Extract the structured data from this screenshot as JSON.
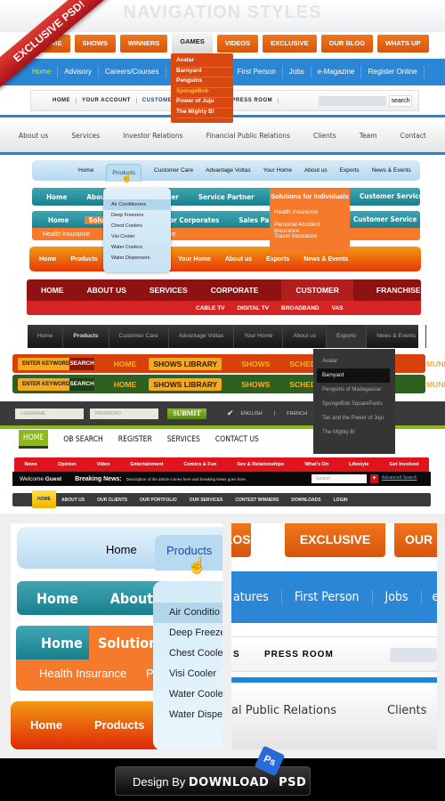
{
  "header": {
    "title": "NAVIGATION STYLES",
    "ribbon": "EXCLUSIVE PSD!"
  },
  "orange_tabs": [
    "HOME",
    "SHOWS",
    "WINNERS",
    "GAMES",
    "VIDEOS",
    "EXCLUSIVE",
    "OUR BLOG",
    "WHATS UP"
  ],
  "games_dropdown": [
    "Avatar",
    "Barnyard",
    "Penguins",
    "SpongeBob",
    "Power of Juju",
    "The Mighty B!"
  ],
  "blue_nav": [
    "Home",
    "Advisory",
    "Careers/Courses",
    "Regi",
    "eatures",
    "First Person",
    "Jobs",
    "e-Magazine",
    "Register Online"
  ],
  "white_nav": {
    "items": [
      "HOME",
      "YOUR ACCOUNT",
      "CUSTOMER SERVI",
      "CES",
      "PRESS ROOM"
    ],
    "search_button": "search"
  },
  "gray_nav": [
    "About us",
    "Services",
    "Investor Relations",
    "Financial Public Relations",
    "Clients",
    "Team",
    "Contact"
  ],
  "lightblue_nav": [
    "Home",
    "Products",
    "Customer Care",
    "Advantage Voltas",
    "Your Home",
    "About us",
    "Exports",
    "News & Events"
  ],
  "teal_nav1": [
    "Home",
    "About Us",
    "les Partner",
    "Service Partner"
  ],
  "teal_nav1_right": "Customer Service",
  "solutions_individuals": "Solutions for Individuals",
  "solutions_dropdown": [
    "Health Insurance",
    "Personal Accident Insurance",
    "Travel Insurance"
  ],
  "teal_nav2": [
    "Home",
    "Solutions",
    "utions for Corporates",
    "Sales Pa"
  ],
  "teal_nav2_right": "Customer Service",
  "teal_nav2_sub": [
    "Health Insurance",
    "Pe",
    "Travel Insurance"
  ],
  "products_dropdown": [
    "Air Conditioners",
    "Deep Freezers",
    "Chest Coolers",
    "Visi Cooler",
    "Water Coolers",
    "Water Dispensers"
  ],
  "orange_nav": [
    "Home",
    "Products",
    "Advantage Voltas",
    "Your Home",
    "About us",
    "Exports",
    "News & Events"
  ],
  "red_nav": {
    "items": [
      "HOME",
      "ABOUT US",
      "SERVICES",
      "CORPORATE",
      "CUSTOMER",
      "FRANCHISEE"
    ],
    "sub": [
      "CABLE TV",
      "DIGITAL TV",
      "BROADBAND",
      "VAS"
    ]
  },
  "dark_nav": [
    "Home",
    "Products",
    "Customer Care",
    "Advantage Voltas",
    "Your Home",
    "About us",
    "Exports",
    "News & Events"
  ],
  "dark_dropdown": [
    "Avatar",
    "Barnyard",
    "Penguins of Madagascar",
    "SpongeBob SquarePants",
    "Tak and the Power of Juju",
    "The Mighty B!"
  ],
  "keyword_bar": {
    "placeholder": "ENTER KEYWORD",
    "search": "SEARCH",
    "items": [
      "HOME",
      "SHOWS LIBRARY",
      "SHOWS",
      "SCHEDULE",
      "MUNITY"
    ]
  },
  "login_bar": {
    "username": "USERNAME",
    "password": "PASSWORD",
    "submit": "SUBMIT",
    "english": "ENGLISH",
    "sep": "|",
    "french": "FRENCH"
  },
  "green_nav": [
    "HOME",
    "OB SEARCH",
    "REGISTER",
    "SERVICES",
    "CONTACT US"
  ],
  "news_nav": [
    "News",
    "Opinion",
    "Video",
    "Entertainment",
    "Comics & Fun",
    "Sex & Relationships",
    "What's On",
    "Lifestyle",
    "Get Involved"
  ],
  "breaking": {
    "welcome": "Welcome",
    "guest": "Guest",
    "label": "Breaking News:",
    "text": "Description of the article comes here and breaking News goes here.",
    "search": "Search",
    "plus": "+",
    "advanced": "Advanced Search"
  },
  "yellow_nav": {
    "home": "HOME",
    "items": [
      "ABOUT US",
      "OUR CLIENTS",
      "OUR PORTFOLIO",
      "OUR SERVICES",
      "CONTEST WINNERS",
      "DOWNLOADS",
      "LOGIN"
    ]
  },
  "zoom_left": {
    "pill": [
      "Home",
      "Products"
    ],
    "teal1": [
      "Home",
      "About Us"
    ],
    "teal2": [
      "Home",
      "Solutions f"
    ],
    "sub": [
      "Health Insurance",
      "Pe"
    ],
    "dropdown": [
      "Air Conditio",
      "Deep Freeze",
      "Chest Coole",
      "Visi Cooler",
      "Water Coole",
      "Water Dispe"
    ],
    "orange": [
      "Home",
      "Products"
    ]
  },
  "zoom_right": {
    "tabs": [
      "EOS",
      "EXCLUSIVE",
      "OUR"
    ],
    "blue": [
      "atures",
      "First Person",
      "Jobs",
      "e-M"
    ],
    "white": [
      "S",
      "PRESS ROOM"
    ],
    "gray": [
      "al Public Relations",
      "Clients"
    ]
  },
  "footer": {
    "prefix": "Design By",
    "brand": "DOWNLOAD",
    "suffix": "PSD",
    "logo": "Ps"
  },
  "colors": {
    "orange": "#e0600e",
    "blue": "#2b86d6",
    "teal": "#1f8896",
    "red": "#8e1212",
    "green": "#8cb81c",
    "news_red": "#e0141c"
  }
}
